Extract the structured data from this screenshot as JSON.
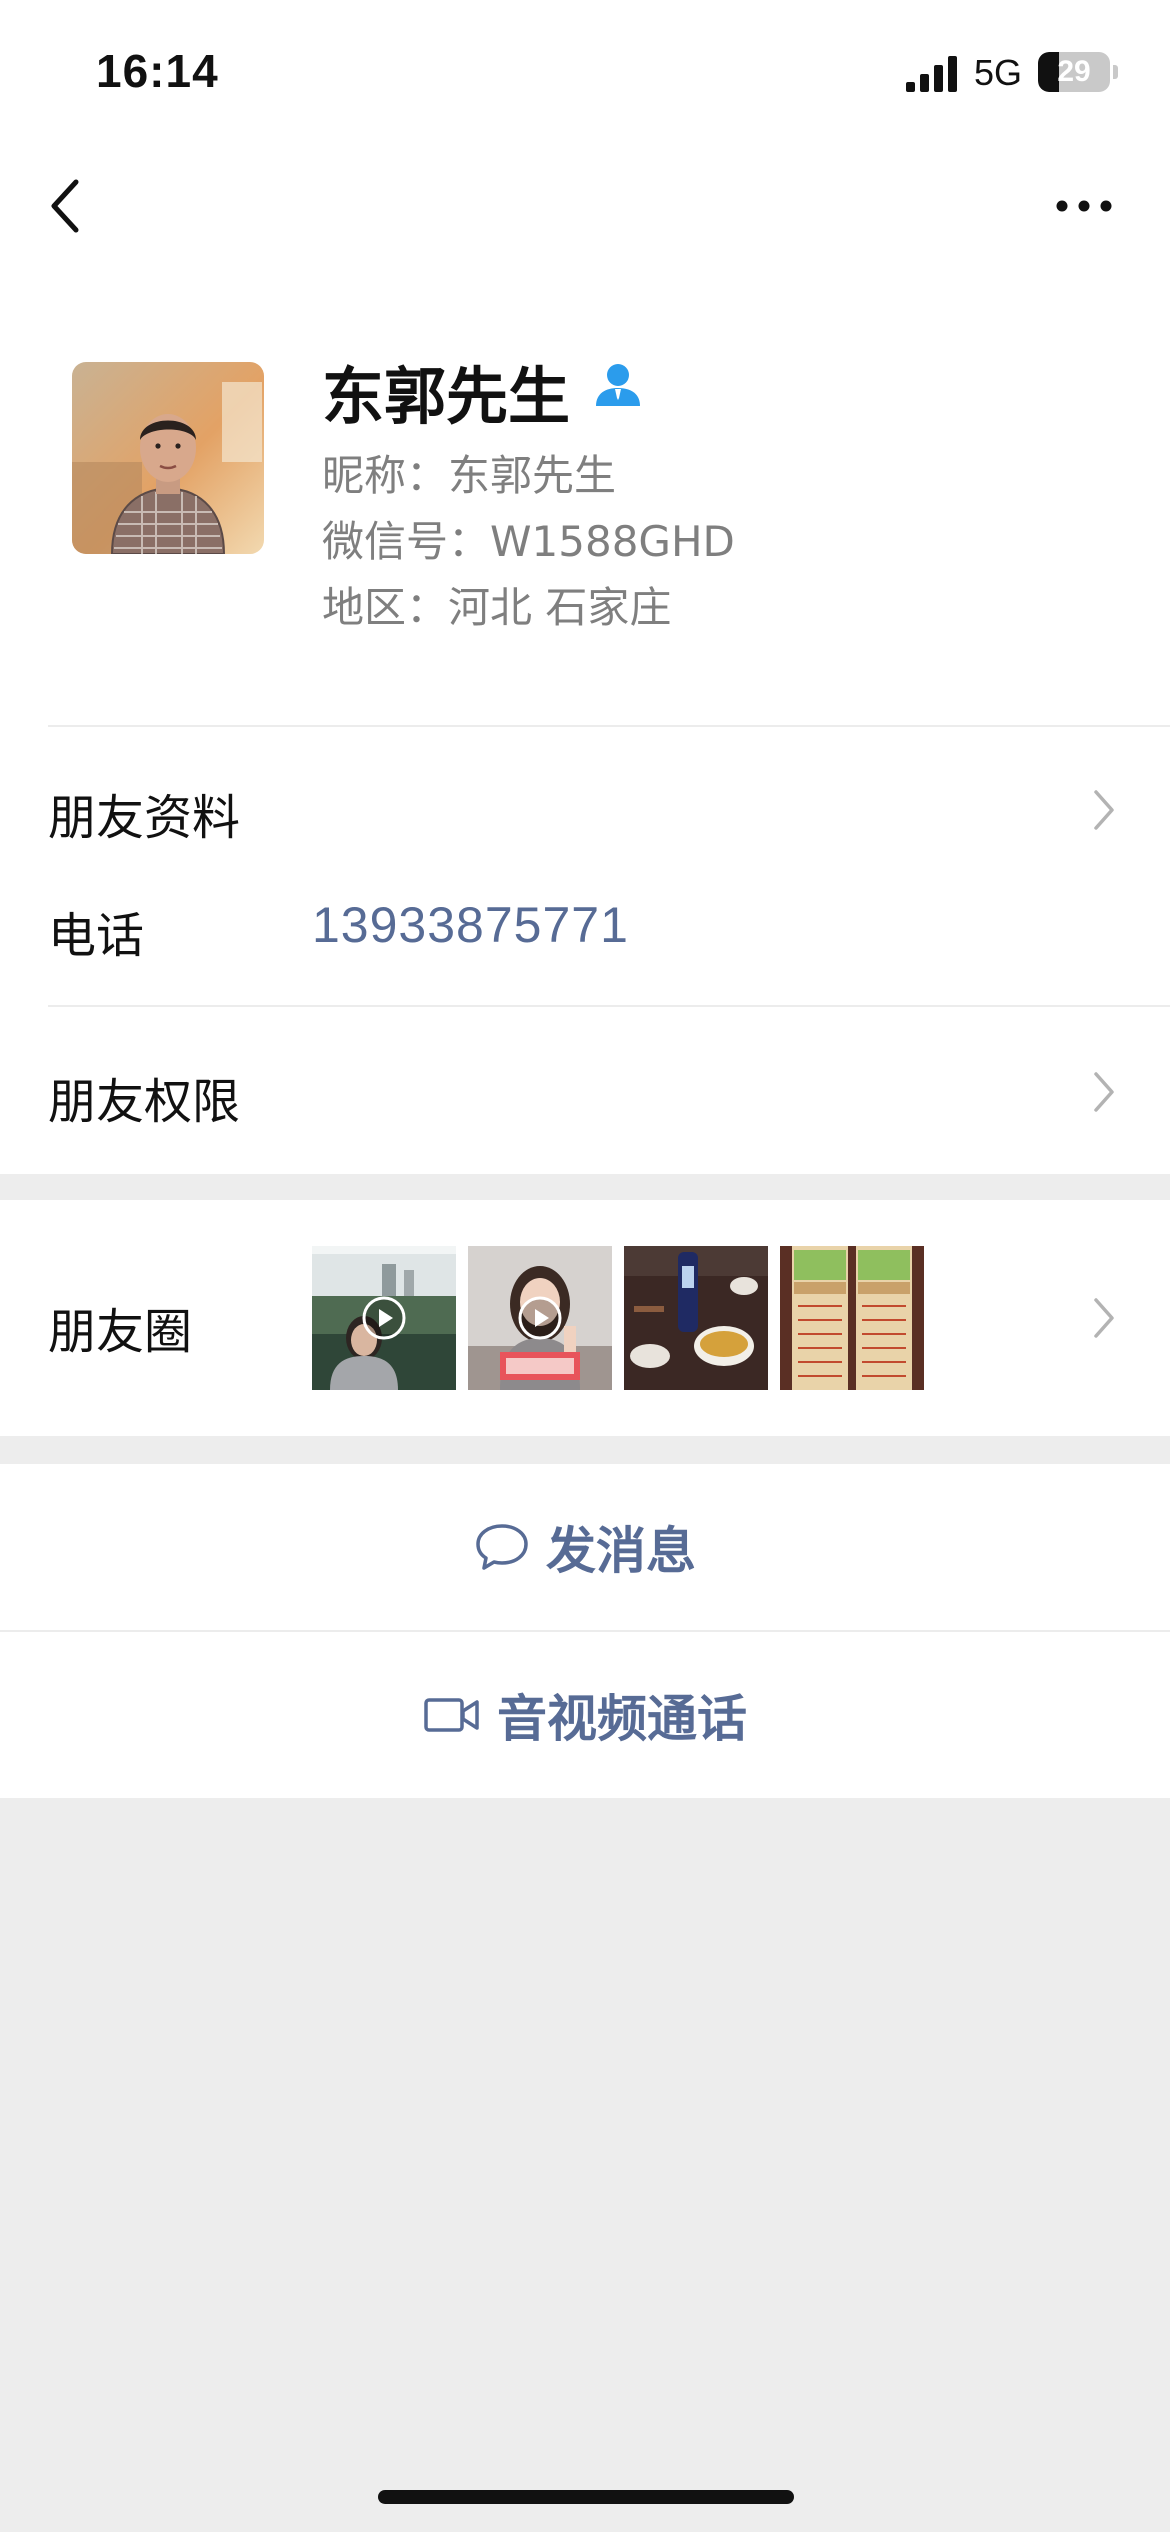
{
  "status_bar": {
    "time": "16:14",
    "network": "5G",
    "battery_level": "29",
    "battery_fraction": 0.29
  },
  "nav": {
    "back_icon": "chevron-left-icon",
    "more_icon": "ellipsis-icon"
  },
  "profile": {
    "name": "东郭先生",
    "nickname": "昵称：东郭先生",
    "wechat_id": "微信号：W1588GHD",
    "region": "地区：河北 石家庄",
    "badge_icon": "person-icon",
    "badge_color": "#2b9cec"
  },
  "rows": {
    "friend_info_label": "朋友资料",
    "phone_label": "电话",
    "phone_number": "13933875771",
    "permissions_label": "朋友权限",
    "moments_label": "朋友圈"
  },
  "moments_thumbnails": [
    {
      "kind": "video",
      "icon": "play-icon"
    },
    {
      "kind": "video",
      "icon": "play-icon"
    },
    {
      "kind": "photo"
    },
    {
      "kind": "photo"
    }
  ],
  "actions": {
    "message_label": "发消息",
    "message_icon": "chat-bubble-icon",
    "call_label": "音视频通话",
    "call_icon": "video-camera-icon"
  },
  "colors": {
    "link": "#576b95",
    "background": "#ededed",
    "secondary_text": "#7f7f7f"
  }
}
